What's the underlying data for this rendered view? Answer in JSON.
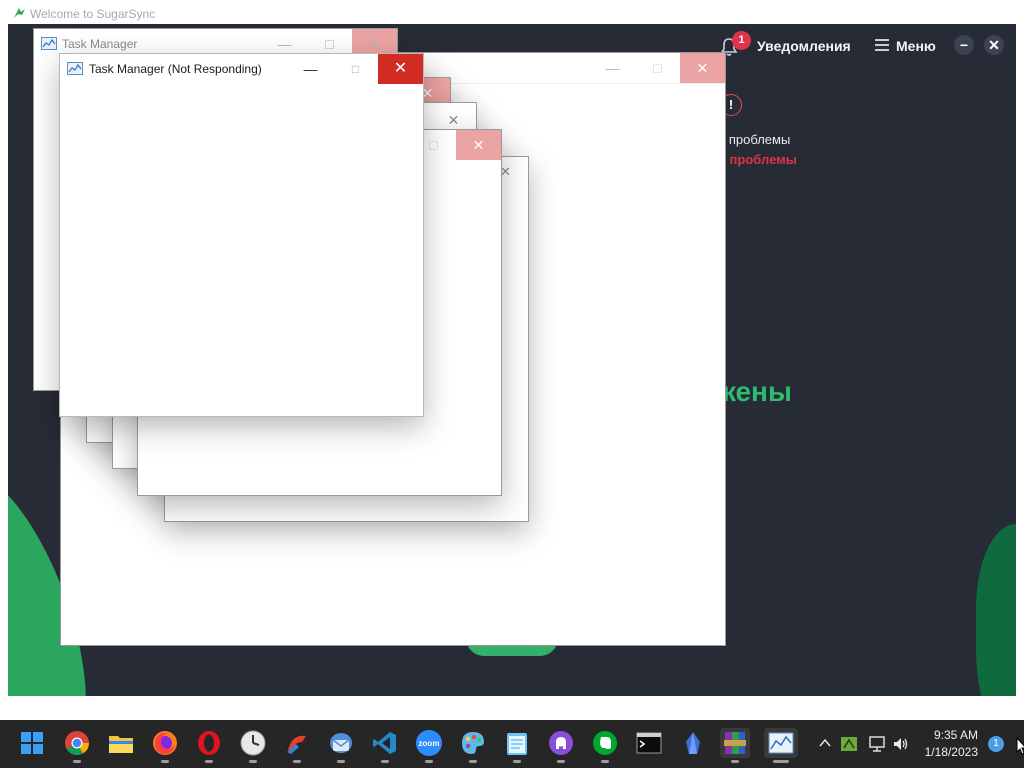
{
  "background_app": {
    "window_title": "Welcome to SugarSync",
    "notification_count": "1",
    "notifications_label": "Уведомления",
    "menu_label": "Меню",
    "alert_mark": "!",
    "problem_text_1": "е проблемы",
    "problem_text_2": "о проблемы",
    "big_text": "жены",
    "accent_green": "#2dbb6f",
    "accent_red": "#e0324b"
  },
  "windows": {
    "ghost_title": "Task Manager",
    "front_title": "Task Manager (Not Responding)"
  },
  "taskbar": {
    "apps": [
      "windows-start",
      "chrome",
      "file-explorer",
      "firefox",
      "opera",
      "clock-app",
      "ccleaner",
      "mail-app",
      "vscode",
      "zoom",
      "paint-app",
      "notepad",
      "github-desktop",
      "evernote",
      "terminal",
      "crystal-app",
      "winrar",
      "task-manager"
    ],
    "zoom_label": "zoom",
    "time": "9:35 AM",
    "date": "1/18/2023",
    "notification_count": "1"
  }
}
